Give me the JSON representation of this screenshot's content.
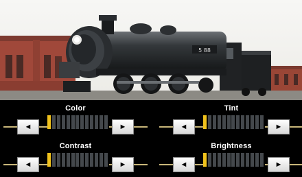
{
  "controls": [
    {
      "id": "color",
      "label": "Color",
      "level_segments": 1,
      "total_segments": 13,
      "decrease_glyph": "◄",
      "increase_glyph": "►"
    },
    {
      "id": "tint",
      "label": "Tint",
      "level_segments": 1,
      "total_segments": 13,
      "decrease_glyph": "◄",
      "increase_glyph": "►"
    },
    {
      "id": "contrast",
      "label": "Contrast",
      "level_segments": 1,
      "total_segments": 13,
      "decrease_glyph": "◄",
      "increase_glyph": "►"
    },
    {
      "id": "brightness",
      "label": "Brightness",
      "level_segments": 1,
      "total_segments": 13,
      "decrease_glyph": "◄",
      "increase_glyph": "►"
    }
  ],
  "colors": {
    "active_segment": "#f0c21c",
    "inactive_segment": "#44484c",
    "track": "#c9b77a",
    "panel_background": "#000000"
  },
  "photo": {
    "subject": "steam-locomotive",
    "number_plate": ""
  }
}
